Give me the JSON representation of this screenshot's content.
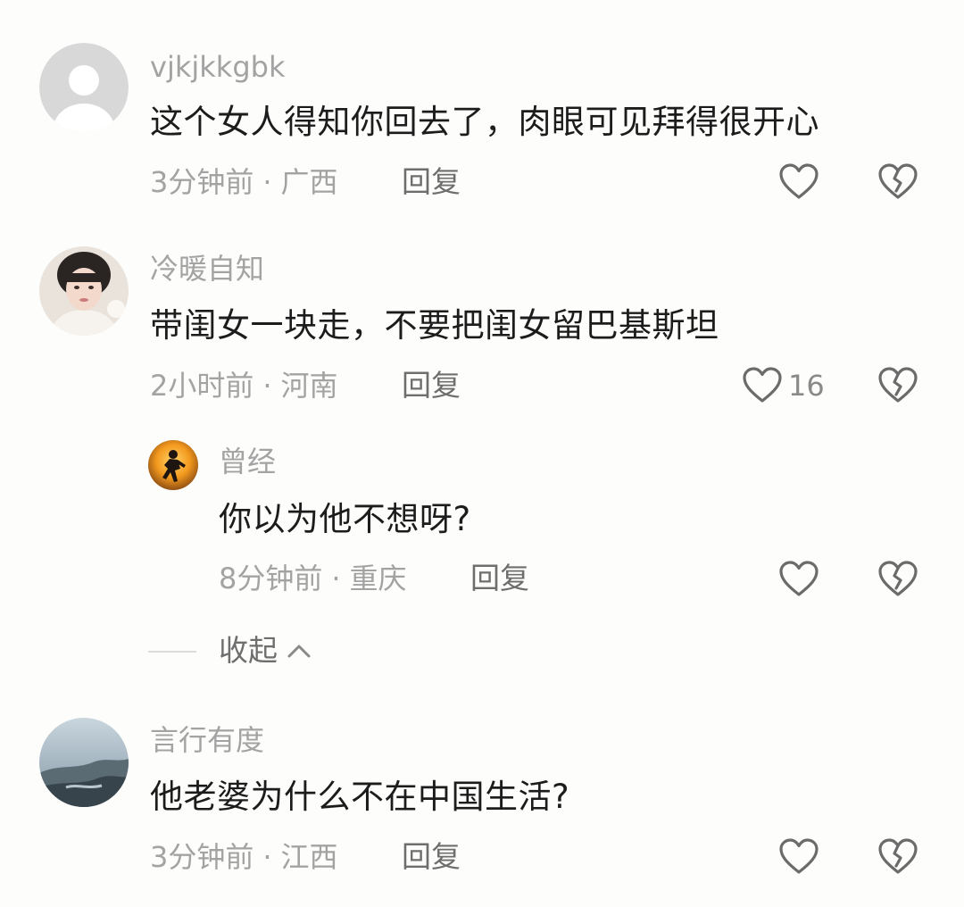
{
  "comments": [
    {
      "username": "vjkjkkgbk",
      "text": "这个女人得知你回去了，肉眼可见拜得很开心",
      "time": "3分钟前",
      "location": "广西",
      "reply_label": "回复",
      "like_icon": "heart-outline-icon",
      "dislike_icon": "broken-heart-icon"
    },
    {
      "username": "冷暖自知",
      "text": "带闺女一块走，不要把闺女留巴基斯坦",
      "time": "2小时前",
      "location": "河南",
      "reply_label": "回复",
      "likes": "16",
      "like_icon": "heart-outline-icon",
      "dislike_icon": "broken-heart-icon",
      "replies": [
        {
          "username": "曾经",
          "text": "你以为他不想呀?",
          "time": "8分钟前",
          "location": "重庆",
          "reply_label": "回复",
          "like_icon": "heart-outline-icon",
          "dislike_icon": "broken-heart-icon"
        }
      ],
      "collapse_label": "收起"
    },
    {
      "username": "言行有度",
      "text": "他老婆为什么不在中国生活?",
      "time": "3分钟前",
      "location": "江西",
      "reply_label": "回复",
      "like_icon": "heart-outline-icon",
      "dislike_icon": "broken-heart-icon"
    }
  ],
  "separator": "·",
  "colors": {
    "background": "#fdfdfb",
    "username": "#a3a3a3",
    "text": "#1c1c1c",
    "meta": "#a3a3a3",
    "reply": "#6e6e6e",
    "icon": "#6b6b6b"
  }
}
